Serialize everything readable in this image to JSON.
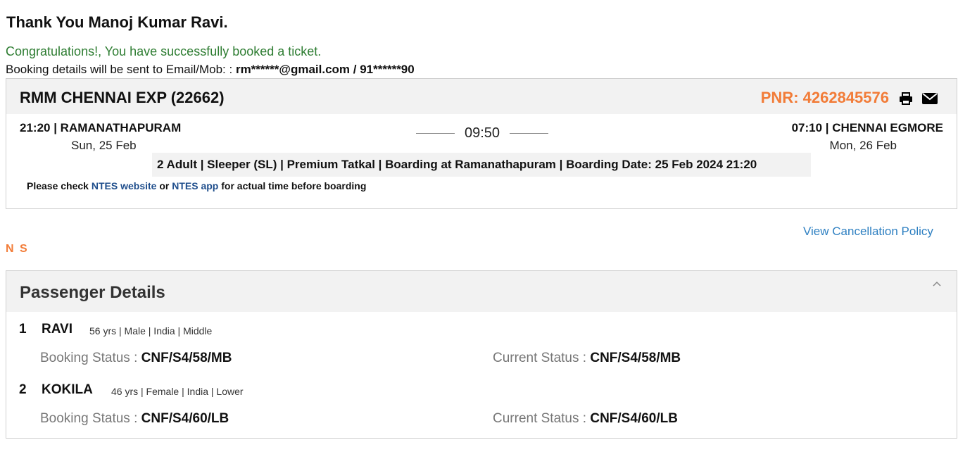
{
  "greeting": "Thank You Manoj Kumar Ravi.",
  "congrats": "Congratulations!, You have successfully booked a ticket.",
  "details": {
    "label": "Booking details will be sent to Email/Mob: :",
    "contact": "rm******@gmail.com / 91******90"
  },
  "train": {
    "name": "RMM CHENNAI EXP (22662)",
    "pnr": "PNR: 4262845576",
    "departure": {
      "time_station": "21:20 | RAMANATHAPURAM",
      "date": "Sun, 25 Feb"
    },
    "duration": "09:50",
    "arrival": {
      "time_station": "07:10 | CHENNAI EGMORE",
      "date": "Mon, 26 Feb"
    },
    "journey_info": "2 Adult | Sleeper (SL) | Premium Tatkal | Boarding at Ramanathapuram | Boarding Date: 25 Feb 2024 21:20",
    "note": {
      "prefix": "Please check",
      "link1": "NTES website",
      "middle": "or",
      "link2": "NTES app",
      "suffix": "for actual time before boarding"
    }
  },
  "cancellation_link": "View Cancellation Policy",
  "ns_label": "N S",
  "passengers_section": {
    "title": "Passenger Details",
    "booking_label": "Booking Status :",
    "current_label": "Current Status :",
    "list": [
      {
        "num": "1",
        "name": "RAVI",
        "meta": "56 yrs | Male | India | Middle",
        "booking_status": "CNF/S4/58/MB",
        "current_status": "CNF/S4/58/MB"
      },
      {
        "num": "2",
        "name": "KOKILA",
        "meta": "46 yrs | Female | India | Lower",
        "booking_status": "CNF/S4/60/LB",
        "current_status": "CNF/S4/60/LB"
      }
    ]
  },
  "colors": {
    "accent_orange": "#f27c38",
    "success_green": "#2e7d32",
    "link_blue": "#2d7fc1",
    "panel_grey": "#f2f2f2"
  },
  "icons": {
    "print": "print-icon",
    "mail": "mail-icon",
    "collapse": "chevron-up-icon"
  }
}
